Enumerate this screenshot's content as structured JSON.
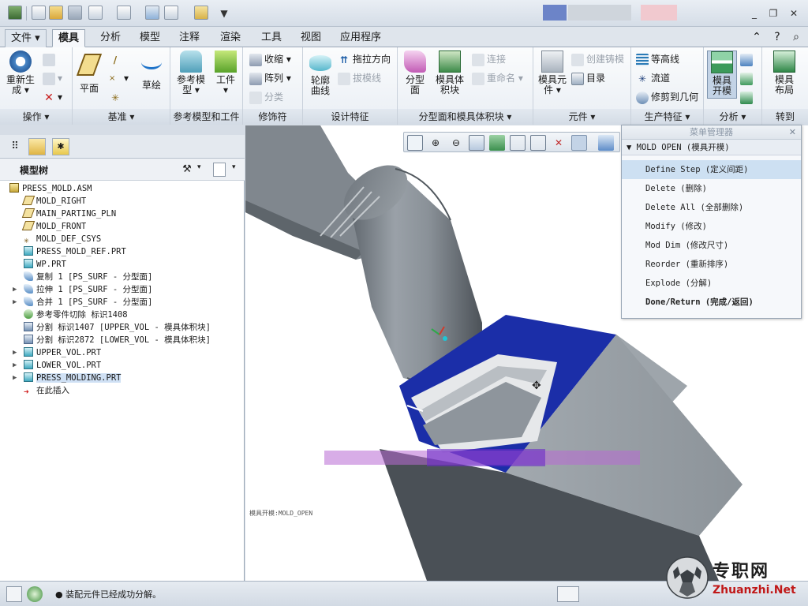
{
  "tabs": [
    {
      "label": "文件",
      "has_menu": true
    },
    {
      "label": "模具",
      "active": true
    },
    {
      "label": "分析"
    },
    {
      "label": "模型"
    },
    {
      "label": "注释"
    },
    {
      "label": "渲染"
    },
    {
      "label": "工具"
    },
    {
      "label": "视图"
    },
    {
      "label": "应用程序"
    }
  ],
  "ribbon": {
    "ops": {
      "label": "操作",
      "regen": "重新生\n成",
      "regen_l1": "重新生",
      "regen_l2": "成"
    },
    "datum": {
      "label": "基准",
      "plane": "平面",
      "sketch": "草绘"
    },
    "refmodel": {
      "label": "参考模型和工件",
      "ref_l1": "参考模",
      "ref_l2": "型",
      "workpiece": "工件"
    },
    "decor": {
      "label": "修饰符",
      "shrink": "收缩",
      "pattern": "阵列",
      "classify": "分类"
    },
    "design": {
      "label": "设计特征",
      "contour_l1": "轮廓",
      "contour_l2": "曲线",
      "pull_dir": "拖拉方向",
      "draft_line": "拔模线"
    },
    "parting": {
      "label": "分型面和模具体积块",
      "surf_l1": "分型",
      "surf_l2": "面",
      "vol_l1": "模具体",
      "vol_l2": "积块",
      "connect": "连接",
      "rename": "重命名"
    },
    "component": {
      "label": "元件",
      "comp_l1": "模具元",
      "comp_l2": "件",
      "create_cast": "创建铸模",
      "catalog": "目录"
    },
    "production": {
      "label": "生产特征",
      "contour": "等高线",
      "flow": "流道",
      "trim": "修剪到几何"
    },
    "analysis": {
      "label": "分析",
      "open_l1": "模具",
      "open_l2": "开模"
    },
    "goto": {
      "label": "转到",
      "layout_l1": "模具",
      "layout_l2": "布局"
    }
  },
  "model_tree": {
    "title": "模型树",
    "items": [
      {
        "label": "PRESS_MOLD.ASM",
        "icon": "assembly-icon",
        "level": 0
      },
      {
        "label": "MOLD_RIGHT",
        "icon": "datum-plane-icon",
        "level": 1
      },
      {
        "label": "MAIN_PARTING_PLN",
        "icon": "datum-plane-icon",
        "level": 1
      },
      {
        "label": "MOLD_FRONT",
        "icon": "datum-plane-icon",
        "level": 1
      },
      {
        "label": "MOLD_DEF_CSYS",
        "icon": "csys-icon",
        "level": 1
      },
      {
        "label": "PRESS_MOLD_REF.PRT",
        "icon": "part-icon",
        "level": 1
      },
      {
        "label": "WP.PRT",
        "icon": "part-icon",
        "level": 1
      },
      {
        "label": "复制 1 [PS_SURF - 分型面]",
        "icon": "surface-icon",
        "level": 1
      },
      {
        "label": "拉伸 1 [PS_SURF - 分型面]",
        "icon": "surface-icon",
        "level": 1,
        "expandable": true
      },
      {
        "label": "合并 1 [PS_SURF - 分型面]",
        "icon": "surface-icon",
        "level": 1,
        "expandable": true
      },
      {
        "label": "参考零件切除 标识1408",
        "icon": "cut-icon",
        "level": 1
      },
      {
        "label": "分割 标识1407 [UPPER_VOL - 模具体积块]",
        "icon": "split-icon",
        "level": 1
      },
      {
        "label": "分割 标识2872 [LOWER_VOL - 模具体积块]",
        "icon": "split-icon",
        "level": 1
      },
      {
        "label": "UPPER_VOL.PRT",
        "icon": "part-icon",
        "level": 1,
        "expandable": true
      },
      {
        "label": "LOWER_VOL.PRT",
        "icon": "part-icon",
        "level": 1,
        "expandable": true
      },
      {
        "label": "PRESS_MOLDING.PRT",
        "icon": "part-icon",
        "level": 1,
        "expandable": true,
        "selected": true
      },
      {
        "label": "在此插入",
        "icon": "insert-arrow-icon",
        "level": 1
      }
    ]
  },
  "menu_manager": {
    "title": "菜单管理器",
    "section": "MOLD OPEN (模具开模)",
    "items": [
      {
        "label": "Define Step (定义间距)",
        "highlight": true
      },
      {
        "label": "Delete (删除)"
      },
      {
        "label": "Delete All (全部删除)"
      },
      {
        "label": "Modify (修改)"
      },
      {
        "label": "Mod Dim (修改尺寸)"
      },
      {
        "label": "Reorder (重新排序)"
      },
      {
        "label": "Explode (分解)"
      },
      {
        "label": "Done/Return (完成/返回)",
        "bold": true
      }
    ]
  },
  "viewport": {
    "label": "模具开模:MOLD_OPEN"
  },
  "status": {
    "message": "装配元件已经成功分解。"
  },
  "watermark": {
    "cn": "专职网",
    "en": "Zhuanzhi.Net"
  },
  "colors": {
    "ribbon_bg": "#eef2f6",
    "blue_plate": "#1b2ea8",
    "part_gray": "#8e959c",
    "block_gray": "#9ea5ab",
    "menu_highlight": "#cde0f2"
  }
}
